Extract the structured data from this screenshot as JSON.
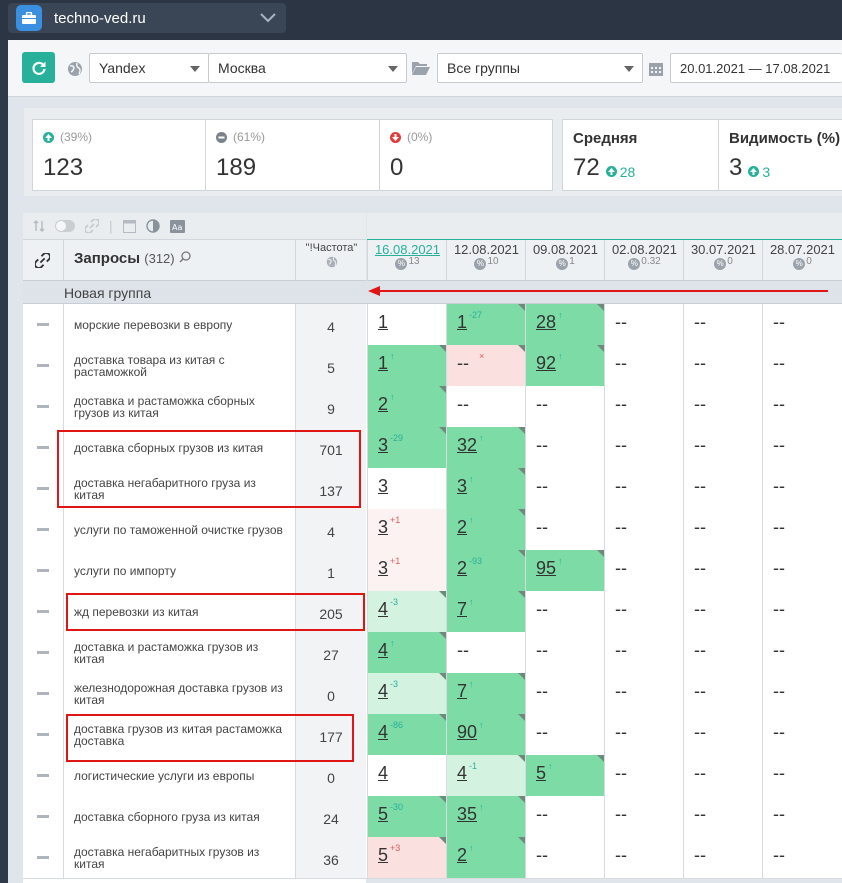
{
  "project": {
    "name": "techno-ved.ru"
  },
  "toolbar": {
    "engine": "Yandex",
    "region": "Москва",
    "group": "Все группы",
    "date_range": "20.01.2021 — 17.08.2021"
  },
  "summary": {
    "up": {
      "pct": "(39%)",
      "count": "123"
    },
    "same": {
      "pct": "(61%)",
      "count": "189"
    },
    "down": {
      "pct": "(0%)",
      "count": "0"
    },
    "average": {
      "title": "Средняя",
      "value": "72",
      "delta": "28"
    },
    "visibility": {
      "title": "Видимость (%)",
      "value": "3",
      "delta": "3"
    }
  },
  "table": {
    "queries_label": "Запросы",
    "queries_count": "(312)",
    "freq_label": "\"!Частота\"",
    "group_name": "Новая группа",
    "dates": [
      {
        "date": "16.08.2021",
        "pct": "13"
      },
      {
        "date": "12.08.2021",
        "pct": "10"
      },
      {
        "date": "09.08.2021",
        "pct": "1"
      },
      {
        "date": "02.08.2021",
        "pct": "0.32"
      },
      {
        "date": "30.07.2021",
        "pct": "0"
      },
      {
        "date": "28.07.2021",
        "pct": "0"
      }
    ],
    "rows": [
      {
        "query": "морские перевозки в европу",
        "freq": "4",
        "cells": [
          {
            "v": "1",
            "c": "",
            "bg": "wh"
          },
          {
            "v": "1",
            "c": "-27",
            "bg": "g",
            "cc": "#27b09a"
          },
          {
            "v": "28",
            "c": "↑",
            "bg": "g",
            "cc": "#27b09a"
          },
          {
            "v": "--"
          },
          {
            "v": "--"
          },
          {
            "v": "--"
          }
        ]
      },
      {
        "query": "доставка товара из китая с растаможкой",
        "freq": "5",
        "cells": [
          {
            "v": "1",
            "c": "↑",
            "bg": "g",
            "cc": "#27b09a"
          },
          {
            "v": "--",
            "c": "×",
            "bg": "pk",
            "cc": "#e05a5a"
          },
          {
            "v": "92",
            "c": "↑",
            "bg": "g",
            "cc": "#27b09a"
          },
          {
            "v": "--"
          },
          {
            "v": "--"
          },
          {
            "v": "--"
          }
        ]
      },
      {
        "query": "доставка и растаможка сборных грузов из китая",
        "freq": "9",
        "cells": [
          {
            "v": "2",
            "c": "↑",
            "bg": "g",
            "cc": "#27b09a"
          },
          {
            "v": "--"
          },
          {
            "v": "--"
          },
          {
            "v": "--"
          },
          {
            "v": "--"
          },
          {
            "v": "--"
          }
        ]
      },
      {
        "query": "доставка сборных грузов из китая",
        "freq": "701",
        "cells": [
          {
            "v": "3",
            "c": "-29",
            "bg": "g",
            "cc": "#27b09a"
          },
          {
            "v": "32",
            "c": "↑",
            "bg": "g",
            "cc": "#27b09a"
          },
          {
            "v": "--"
          },
          {
            "v": "--"
          },
          {
            "v": "--"
          },
          {
            "v": "--"
          }
        ]
      },
      {
        "query": "доставка негабаритного груза из китая",
        "freq": "137",
        "cells": [
          {
            "v": "3",
            "c": "",
            "bg": "wh"
          },
          {
            "v": "3",
            "c": "↑",
            "bg": "g",
            "cc": "#27b09a"
          },
          {
            "v": "--"
          },
          {
            "v": "--"
          },
          {
            "v": "--"
          },
          {
            "v": "--"
          }
        ]
      },
      {
        "query": "услуги по таможенной очистке грузов",
        "freq": "4",
        "cells": [
          {
            "v": "3",
            "c": "+1",
            "bg": "lpk",
            "cc": "#e05a5a"
          },
          {
            "v": "2",
            "c": "↑",
            "bg": "g",
            "cc": "#27b09a"
          },
          {
            "v": "--"
          },
          {
            "v": "--"
          },
          {
            "v": "--"
          },
          {
            "v": "--"
          }
        ]
      },
      {
        "query": "услуги по импорту",
        "freq": "1",
        "cells": [
          {
            "v": "3",
            "c": "+1",
            "bg": "lpk",
            "cc": "#e05a5a"
          },
          {
            "v": "2",
            "c": "-93",
            "bg": "g",
            "cc": "#27b09a"
          },
          {
            "v": "95",
            "c": "↑",
            "bg": "g",
            "cc": "#27b09a"
          },
          {
            "v": "--"
          },
          {
            "v": "--"
          },
          {
            "v": "--"
          }
        ]
      },
      {
        "query": "жд перевозки из китая",
        "freq": "205",
        "cells": [
          {
            "v": "4",
            "c": "-3",
            "bg": "lg",
            "cc": "#27b09a"
          },
          {
            "v": "7",
            "c": "↑",
            "bg": "g",
            "cc": "#27b09a"
          },
          {
            "v": "--"
          },
          {
            "v": "--"
          },
          {
            "v": "--"
          },
          {
            "v": "--"
          }
        ]
      },
      {
        "query": "доставка и растаможка грузов из китая",
        "freq": "27",
        "cells": [
          {
            "v": "4",
            "c": "↑",
            "bg": "g",
            "cc": "#27b09a"
          },
          {
            "v": "--"
          },
          {
            "v": "--"
          },
          {
            "v": "--"
          },
          {
            "v": "--"
          },
          {
            "v": "--"
          }
        ]
      },
      {
        "query": "железнодорожная доставка грузов из китая",
        "freq": "0",
        "cells": [
          {
            "v": "4",
            "c": "-3",
            "bg": "lg",
            "cc": "#27b09a"
          },
          {
            "v": "7",
            "c": "↑",
            "bg": "g",
            "cc": "#27b09a"
          },
          {
            "v": "--"
          },
          {
            "v": "--"
          },
          {
            "v": "--"
          },
          {
            "v": "--"
          }
        ]
      },
      {
        "query": "доставка грузов из китая растаможка доставка",
        "freq": "177",
        "cells": [
          {
            "v": "4",
            "c": "-86",
            "bg": "g",
            "cc": "#27b09a"
          },
          {
            "v": "90",
            "c": "↑",
            "bg": "g",
            "cc": "#27b09a"
          },
          {
            "v": "--"
          },
          {
            "v": "--"
          },
          {
            "v": "--"
          },
          {
            "v": "--"
          }
        ]
      },
      {
        "query": "логистические услуги из европы",
        "freq": "0",
        "cells": [
          {
            "v": "4",
            "c": "",
            "bg": "wh"
          },
          {
            "v": "4",
            "c": "-1",
            "bg": "lg",
            "cc": "#27b09a"
          },
          {
            "v": "5",
            "c": "↑",
            "bg": "g",
            "cc": "#27b09a"
          },
          {
            "v": "--"
          },
          {
            "v": "--"
          },
          {
            "v": "--"
          }
        ]
      },
      {
        "query": "доставка сборного груза из китая",
        "freq": "24",
        "cells": [
          {
            "v": "5",
            "c": "-30",
            "bg": "g",
            "cc": "#27b09a"
          },
          {
            "v": "35",
            "c": "↑",
            "bg": "g",
            "cc": "#27b09a"
          },
          {
            "v": "--"
          },
          {
            "v": "--"
          },
          {
            "v": "--"
          },
          {
            "v": "--"
          }
        ]
      },
      {
        "query": "доставка негабаритных грузов из китая",
        "freq": "36",
        "cells": [
          {
            "v": "5",
            "c": "+3",
            "bg": "pk",
            "cc": "#e05a5a"
          },
          {
            "v": "2",
            "c": "↑",
            "bg": "g",
            "cc": "#27b09a"
          },
          {
            "v": "--"
          },
          {
            "v": "--"
          },
          {
            "v": "--"
          },
          {
            "v": "--"
          }
        ]
      }
    ]
  },
  "colors": {
    "accent": "#27b09a",
    "positive": "#7ddca6",
    "negative": "#fbe0e0",
    "highlight": "#e01515"
  }
}
